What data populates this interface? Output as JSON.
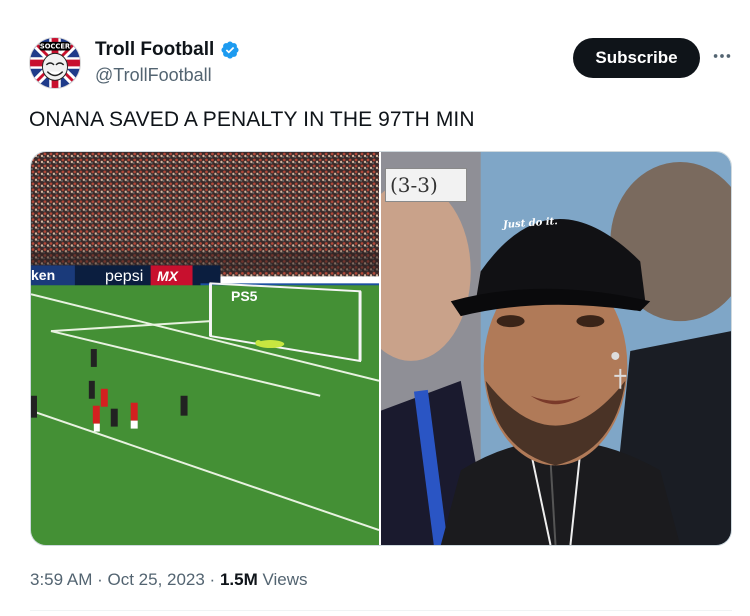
{
  "author": {
    "display_name": "Troll Football",
    "handle": "@TrollFootball",
    "avatar_text": "SOCCER"
  },
  "actions": {
    "subscribe_label": "Subscribe",
    "more_icon": "more-horizontal-icon"
  },
  "tweet": {
    "text": "ONANA SAVED A PENALTY IN THE 97TH MIN"
  },
  "media": {
    "left_image": {
      "ad_boards": [
        "ken",
        "pepsi",
        "MX",
        "PS5"
      ]
    },
    "right_image": {
      "score_caption": "(3-3)",
      "cap_text": "Just do it."
    }
  },
  "meta": {
    "time": "3:59 AM",
    "separator1": " · ",
    "date": "Oct 25, 2023",
    "separator2": " · ",
    "views_count": "1.5M",
    "views_label": " Views"
  },
  "colors": {
    "brand_dark": "#0f1419",
    "secondary_text": "#536471",
    "verified_blue": "#1d9bf0",
    "pitch_green": "#3f8a2e"
  }
}
